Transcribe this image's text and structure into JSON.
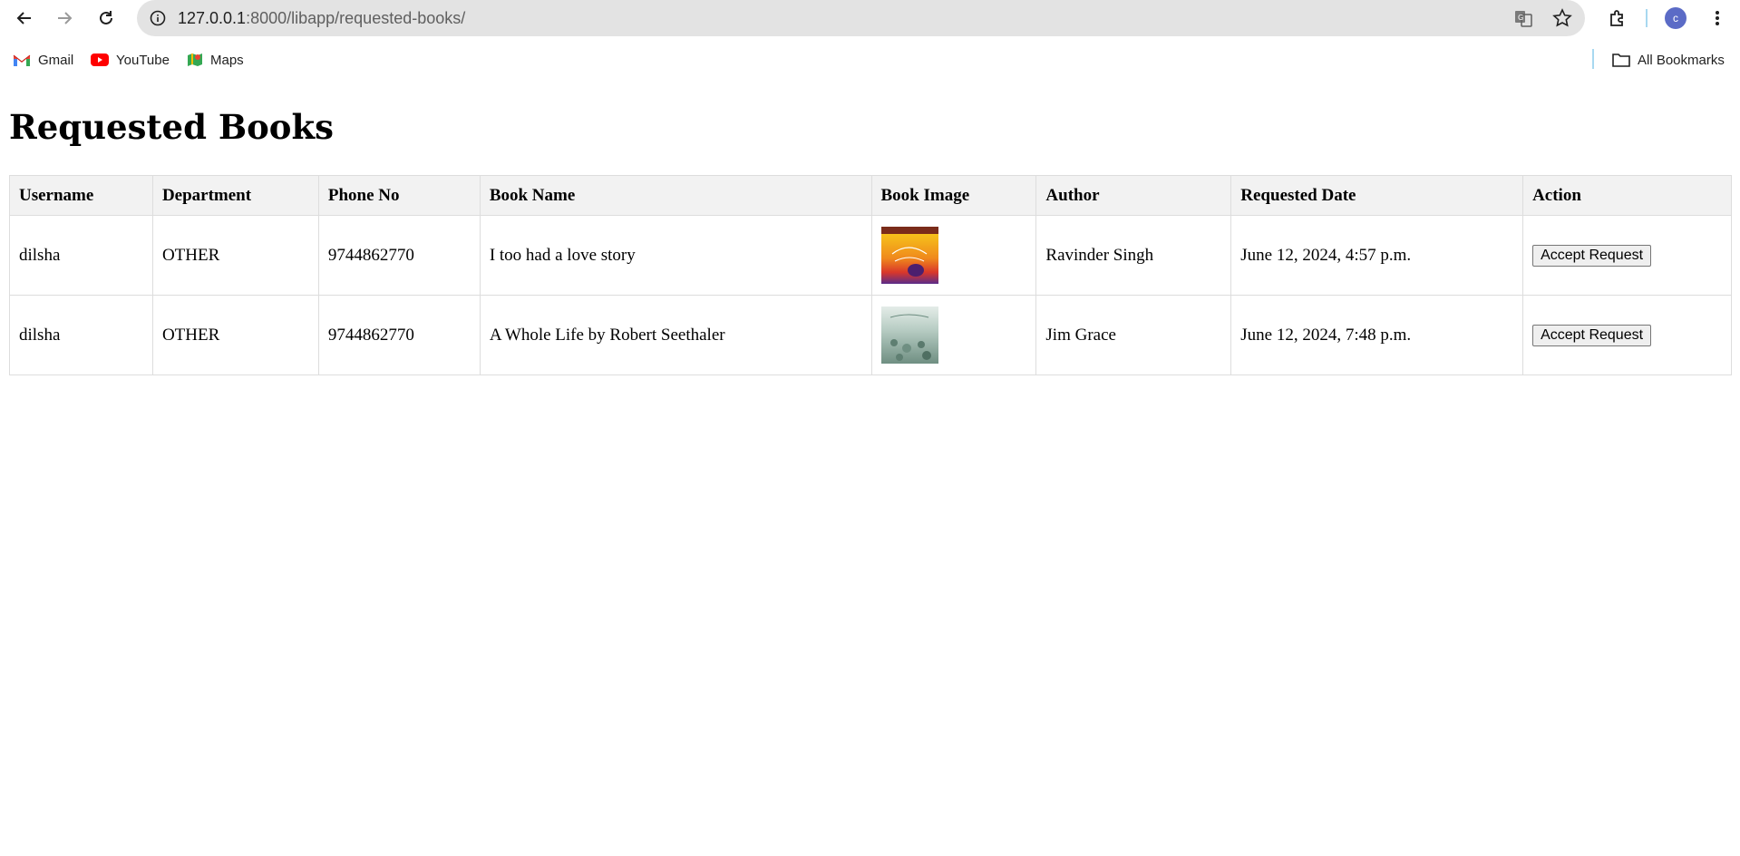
{
  "browser": {
    "url_host": "127.0.0.1",
    "url_path": ":8000/libapp/requested-books/",
    "profile_initial": "c",
    "bookmarks": [
      {
        "label": "Gmail",
        "icon": "gmail-icon"
      },
      {
        "label": "YouTube",
        "icon": "youtube-icon"
      },
      {
        "label": "Maps",
        "icon": "maps-icon"
      }
    ],
    "all_bookmarks_label": "All Bookmarks"
  },
  "page": {
    "title": "Requested Books"
  },
  "table": {
    "headers": [
      "Username",
      "Department",
      "Phone No",
      "Book Name",
      "Book Image",
      "Author",
      "Requested Date",
      "Action"
    ],
    "rows": [
      {
        "username": "dilsha",
        "department": "OTHER",
        "phone": "9744862770",
        "book_name": "I too had a love story",
        "image_label": "book-cover-love-story",
        "author": "Ravinder Singh",
        "requested_date": "June 12, 2024, 4:57 p.m.",
        "action_label": "Accept Request"
      },
      {
        "username": "dilsha",
        "department": "OTHER",
        "phone": "9744862770",
        "book_name": "A Whole Life by Robert Seethaler",
        "image_label": "book-cover-whole-life",
        "author": "Jim Grace",
        "requested_date": "June 12, 2024, 7:48 p.m.",
        "action_label": "Accept Request"
      }
    ]
  },
  "colors": {
    "header_bg": "#f2f2f2",
    "border": "#dddddd",
    "omnibox_bg": "#e3e3e3",
    "profile_bg": "#5b6bc6"
  }
}
